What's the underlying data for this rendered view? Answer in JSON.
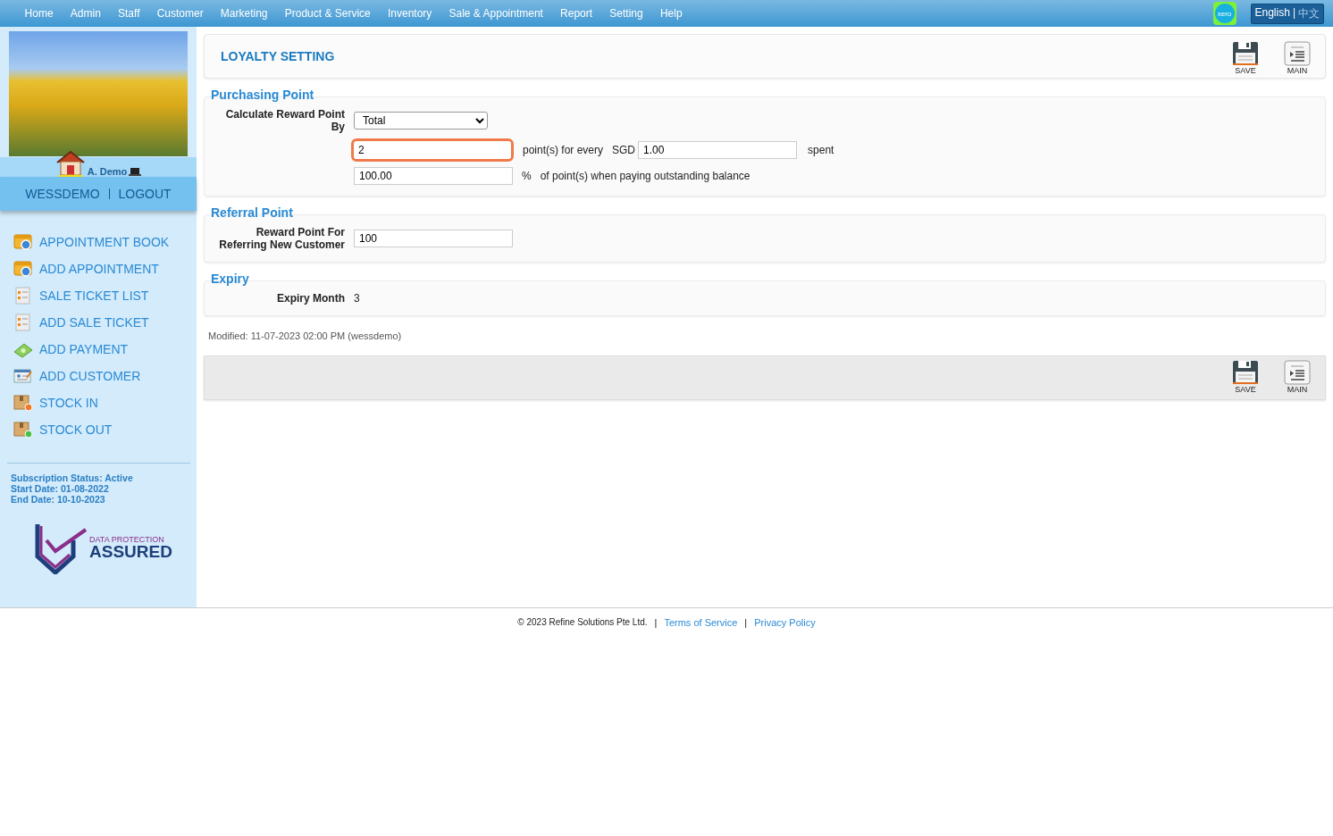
{
  "top_nav": {
    "items": [
      "Home",
      "Admin",
      "Staff",
      "Customer",
      "Marketing",
      "Product & Service",
      "Inventory",
      "Sale & Appointment",
      "Report",
      "Setting",
      "Help"
    ],
    "xero_label": "xero",
    "language": [
      {
        "label": "English",
        "selected": true
      },
      {
        "label": "中文",
        "selected": false
      }
    ],
    "language_separator": "|"
  },
  "sidebar": {
    "user_name": "A. Demo",
    "account": "WESSDEMO",
    "logout": "LOGOUT",
    "menu": [
      {
        "kind": "calendar",
        "label": "APPOINTMENT BOOK"
      },
      {
        "kind": "calendar",
        "label": "ADD APPOINTMENT"
      },
      {
        "kind": "ticket",
        "label": "SALE TICKET LIST"
      },
      {
        "kind": "ticket",
        "label": "ADD SALE TICKET"
      },
      {
        "kind": "money",
        "label": "ADD PAYMENT"
      },
      {
        "kind": "customer",
        "label": "ADD CUSTOMER"
      },
      {
        "kind": "stock-in",
        "label": "STOCK IN"
      },
      {
        "kind": "stock-out",
        "label": "STOCK OUT"
      }
    ],
    "subscription": [
      "Subscription Status: Active",
      "Start Date: 01-08-2022",
      "End Date: 10-10-2023"
    ],
    "badge": {
      "top": "DATA PROTECTION",
      "bottom": "ASSURED"
    }
  },
  "main": {
    "title": "LOYALTY SETTING",
    "toolbar": [
      {
        "kind": "save",
        "label": "SAVE"
      },
      {
        "kind": "main",
        "label": "MAIN"
      }
    ],
    "purchasing": {
      "legend": "Purchasing Point",
      "calc_label": "Calculate Reward Point By",
      "calc_value": "Total",
      "points_value": "2",
      "points_focused": true,
      "points_text": "point(s) for every",
      "currency": "SGD",
      "amount": "1.00",
      "spent": "spent",
      "percent_value": "100.00",
      "percent_sign": "%",
      "percent_text": "of point(s) when paying outstanding balance"
    },
    "referral": {
      "legend": "Referral Point",
      "label": "Reward Point For Referring New Customer",
      "value": "100"
    },
    "expiry": {
      "legend": "Expiry",
      "label": "Expiry Month",
      "value": "3"
    },
    "modified": "Modified: 11-07-2023 02:00 PM (wessdemo)",
    "bottom_toolbar": [
      {
        "kind": "save",
        "label": "SAVE"
      },
      {
        "kind": "main",
        "label": "MAIN"
      }
    ]
  },
  "footer": {
    "copyright": "© 2023 Refine Solutions Pte Ltd.",
    "separators": [
      "|",
      "|"
    ],
    "links": [
      "Terms of Service",
      "Privacy Policy"
    ]
  }
}
